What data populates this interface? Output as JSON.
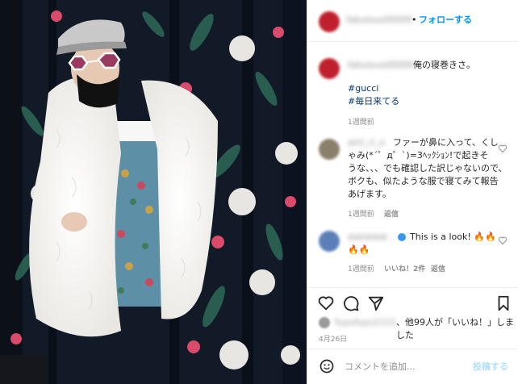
{
  "header": {
    "username": "fabulous00000",
    "follow_separator": "•",
    "follow_label": "フォローする"
  },
  "caption": {
    "username": "fabulous00000",
    "text": "俺の寝巻きさ。",
    "hashtags": [
      "#gucci",
      "#毎日来てる"
    ],
    "time": "1週間前"
  },
  "comments": [
    {
      "username": "ami_ri_o",
      "lines": [
        "ファーが鼻に入って、くし",
        "ゃみ(*´゜д゜`)=3ﾍｯｸｼｮﾝ!で起きそ",
        "うな、、、でも確認した訳じゃないので、",
        "ボクも、似たような服で寝てみて報告",
        "あげます。"
      ],
      "time": "1週間前",
      "reply_label": "返信"
    },
    {
      "username": "aiaiaiaiai",
      "text": "This is a look! 🔥🔥",
      "text_line2": "🔥🔥",
      "time": "1週間前",
      "likes": "いいね！2件",
      "reply_label": "返信"
    }
  ],
  "likes": {
    "liker": "fuyufuyu1111",
    "text": "、他99人が「いいね！」しました"
  },
  "date": "4月26日",
  "comment_input": {
    "placeholder": "コメントを追加...",
    "post_label": "投稿する"
  },
  "icons": [
    "heart-icon",
    "comment-icon",
    "share-icon",
    "bookmark-icon",
    "emoji-icon"
  ],
  "colors": {
    "accent": "#0095f6",
    "text": "#262626",
    "muted": "#8e8e8e",
    "link": "#00376b"
  }
}
